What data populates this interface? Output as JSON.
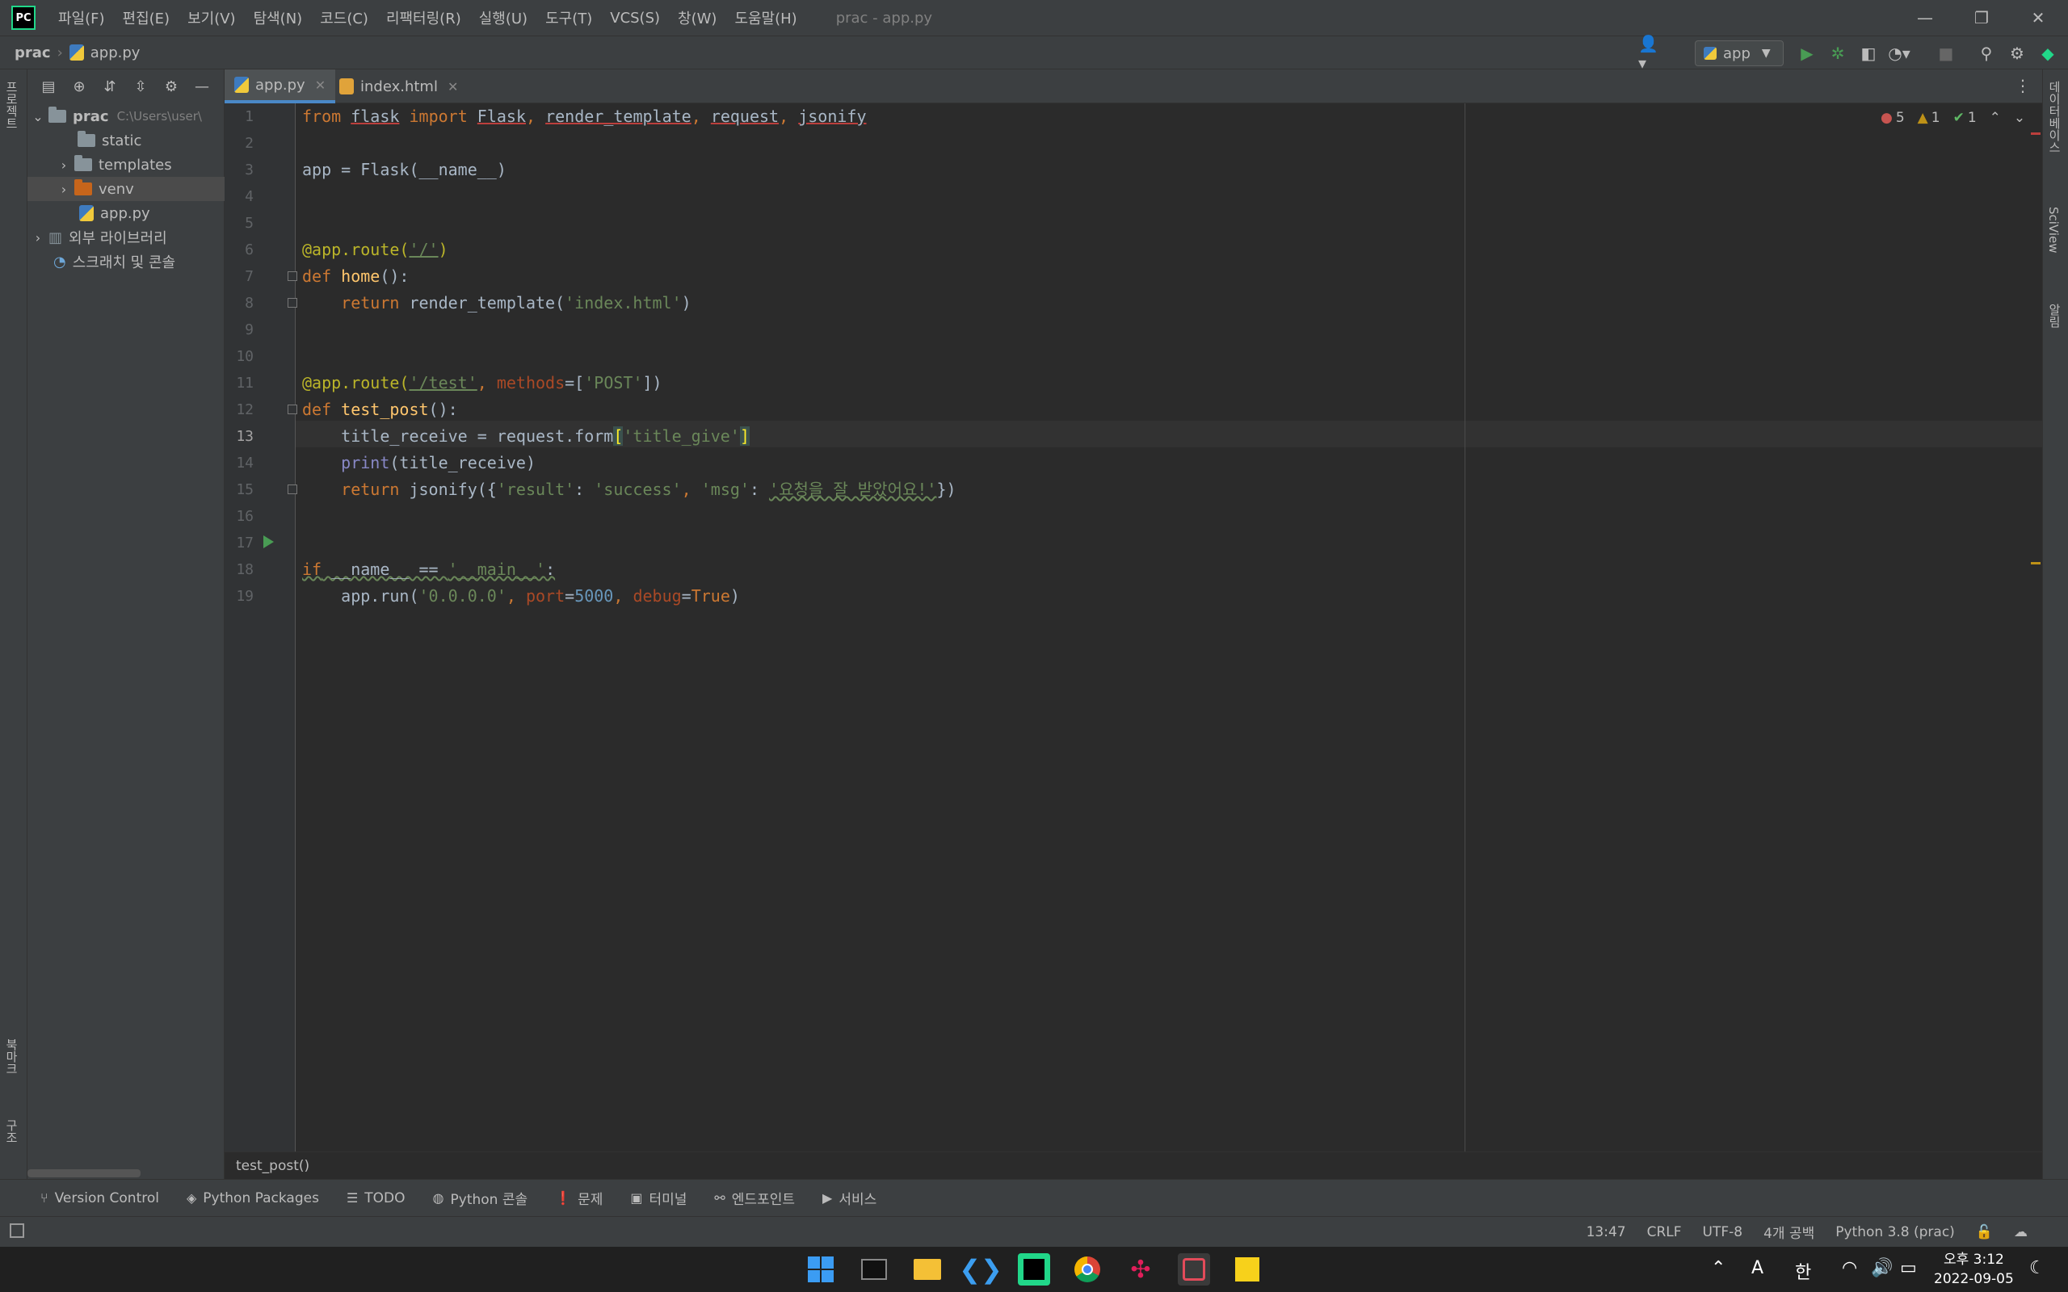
{
  "menu": [
    "파일(F)",
    "편집(E)",
    "보기(V)",
    "탐색(N)",
    "코드(C)",
    "리팩터링(R)",
    "실행(U)",
    "도구(T)",
    "VCS(S)",
    "창(W)",
    "도움말(H)"
  ],
  "window_title": "prac - app.py",
  "app_logo": "PC",
  "breadcrumb": {
    "project": "prac",
    "file": "app.py"
  },
  "run_config": "app",
  "project_panel": {
    "root": "prac",
    "root_path": "C:\\Users\\user\\",
    "items": [
      "static",
      "templates",
      "venv",
      "app.py"
    ],
    "external_libs": "외부 라이브러리",
    "scratches": "스크래치 및 콘솔"
  },
  "left_strip": {
    "project": "프로젝트",
    "bookmarks": "북마크",
    "structure": "구조"
  },
  "right_strip": {
    "database": "데이터베이스",
    "sciview": "SciView",
    "notifications": "알림"
  },
  "tabs": [
    {
      "label": "app.py",
      "active": true
    },
    {
      "label": "index.html",
      "active": false
    }
  ],
  "inspection": {
    "errors": "5",
    "warnings": "1",
    "ok": "1"
  },
  "line_numbers": [
    "1",
    "2",
    "3",
    "4",
    "5",
    "6",
    "7",
    "8",
    "9",
    "10",
    "11",
    "12",
    "13",
    "14",
    "15",
    "16",
    "17",
    "18",
    "19"
  ],
  "current_line": "13",
  "code": {
    "l1": {
      "a": "from",
      "b": " ",
      "c": "flask",
      "d": " ",
      "e": "import",
      "f": " ",
      "g": "Flask",
      "h": ", ",
      "i": "render_template",
      "j": ", ",
      "k": "request",
      "l": ", ",
      "m": "jsonify"
    },
    "l3": {
      "a": "app = Flask(__name__)"
    },
    "l6": {
      "a": "@app.route(",
      "b": "'/'",
      "c": ")"
    },
    "l7": {
      "a": "def",
      "b": " ",
      "c": "home",
      "d": "():"
    },
    "l8": {
      "a": "    ",
      "b": "return",
      "c": " render_template(",
      "d": "'index.html'",
      "e": ")"
    },
    "l11": {
      "a": "@app.route(",
      "b": "'/test'",
      "c": ", ",
      "d": "methods",
      "e": "=[",
      "f": "'POST'",
      "g": "])"
    },
    "l12": {
      "a": "def",
      "b": " ",
      "c": "test_post",
      "d": "():"
    },
    "l13": {
      "a": "    title_receive = request.form",
      "b": "[",
      "c": "'title_give'",
      "d": "]"
    },
    "l14": {
      "a": "    ",
      "b": "print",
      "c": "(title_receive)"
    },
    "l15": {
      "a": "    ",
      "b": "return",
      "c": " jsonify({",
      "d": "'result'",
      "e": ": ",
      "f": "'success'",
      "g": ", ",
      "h": "'msg'",
      "i": ": ",
      "j": "'요청을 잘 받았어요!'",
      "k": "})"
    },
    "l17": {
      "a": "if",
      "b": " __name__ == ",
      "c": "'__main__'",
      "d": ":"
    },
    "l18": {
      "a": "    app.run(",
      "b": "'0.0.0.0'",
      "c": ", ",
      "d": "port",
      "e": "=",
      "f": "5000",
      "g": ", ",
      "h": "debug",
      "i": "=",
      "j": "True",
      "k": ")"
    }
  },
  "editor_breadcrumb": "test_post()",
  "bottom_tools": [
    "Version Control",
    "Python Packages",
    "TODO",
    "Python 콘솔",
    "문제",
    "터미널",
    "엔드포인트",
    "서비스"
  ],
  "status": {
    "position": "13:47",
    "line_sep": "CRLF",
    "encoding": "UTF-8",
    "indent": "4개 공백",
    "interpreter": "Python 3.8 (prac)"
  },
  "tray": {
    "lang": "A",
    "ime": "한"
  },
  "clock": {
    "time": "오후 3:12",
    "date": "2022-09-05"
  },
  "colors": {
    "accent": "#4a88c7",
    "editor_bg": "#2b2b2b",
    "panel_bg": "#3c3f41"
  }
}
